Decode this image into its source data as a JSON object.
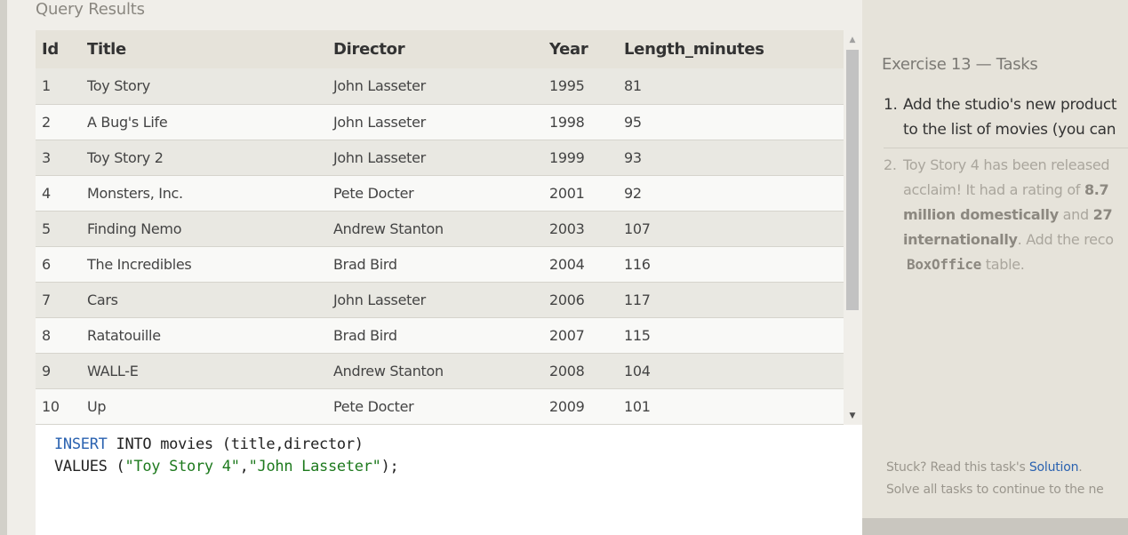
{
  "query_results": {
    "title": "Query Results",
    "columns": [
      "Id",
      "Title",
      "Director",
      "Year",
      "Length_minutes"
    ],
    "rows": [
      [
        "1",
        "Toy Story",
        "John Lasseter",
        "1995",
        "81"
      ],
      [
        "2",
        "A Bug's Life",
        "John Lasseter",
        "1998",
        "95"
      ],
      [
        "3",
        "Toy Story 2",
        "John Lasseter",
        "1999",
        "93"
      ],
      [
        "4",
        "Monsters, Inc.",
        "Pete Docter",
        "2001",
        "92"
      ],
      [
        "5",
        "Finding Nemo",
        "Andrew Stanton",
        "2003",
        "107"
      ],
      [
        "6",
        "The Incredibles",
        "Brad Bird",
        "2004",
        "116"
      ],
      [
        "7",
        "Cars",
        "John Lasseter",
        "2006",
        "117"
      ],
      [
        "8",
        "Ratatouille",
        "Brad Bird",
        "2007",
        "115"
      ],
      [
        "9",
        "WALL-E",
        "Andrew Stanton",
        "2008",
        "104"
      ],
      [
        "10",
        "Up",
        "Pete Docter",
        "2009",
        "101"
      ]
    ],
    "scroll_up_icon": "▲",
    "scroll_down_icon": "▼"
  },
  "editor": {
    "line1": {
      "kw": "INSERT",
      "rest": " INTO movies (title,director)"
    },
    "line2": {
      "pre": "VALUES (",
      "str1": "\"Toy Story 4\"",
      "comma": ",",
      "str2": "\"John Lasseter\"",
      "post": ");"
    }
  },
  "tasks": {
    "title": "Exercise 13 — Tasks",
    "task1": {
      "num": "1.",
      "line1": "Add the studio's new product",
      "line2": "to the list of movies (you can"
    },
    "task2": {
      "num": "2.",
      "line1": "Toy Story 4 has been released",
      "line2_a": "acclaim! It had a rating of ",
      "line2_b": "8.7",
      "line3_a": "million domestically",
      "line3_b": " and ",
      "line3_c": "27",
      "line4_a": "internationally",
      "line4_b": ". Add the reco",
      "line5_a": "BoxOffice",
      "line5_b": " table."
    },
    "stuck_prefix": "Stuck? Read this task's ",
    "solution_link": "Solution",
    "stuck_suffix": ".",
    "solve_text": "Solve all tasks to continue to the ne"
  },
  "colors": {
    "keyword": "#2a62b0",
    "string": "#1e7a1e",
    "link": "#2a62b0"
  }
}
